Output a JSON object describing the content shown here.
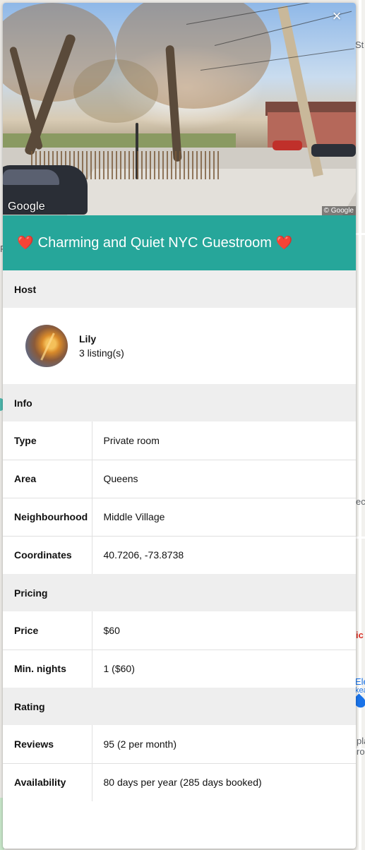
{
  "map": {
    "labels": [
      "St",
      "F",
      "ect",
      "ic",
      "Ele",
      "kea",
      "pla",
      "ron"
    ]
  },
  "photo": {
    "watermark": "Google",
    "copyright": "© Google",
    "close_icon": "×"
  },
  "listing": {
    "title": "Charming and Quiet NYC Guestroom",
    "title_icons": [
      "heart-emoji",
      "heart-emoji"
    ],
    "heart_glyph": "❤️"
  },
  "host_section": {
    "header": "Host",
    "name": "Lily",
    "listings": "3 listing(s)"
  },
  "info_section": {
    "header": "Info",
    "rows": [
      {
        "label": "Type",
        "value": "Private room"
      },
      {
        "label": "Area",
        "value": "Queens"
      },
      {
        "label": "Neighbourhood",
        "value": "Middle Village"
      },
      {
        "label": "Coordinates",
        "value": "40.7206, -73.8738"
      }
    ]
  },
  "pricing_section": {
    "header": "Pricing",
    "rows": [
      {
        "label": "Price",
        "value": "$60"
      },
      {
        "label": "Min. nights",
        "value": "1 ($60)"
      }
    ]
  },
  "rating_section": {
    "header": "Rating",
    "rows": [
      {
        "label": "Reviews",
        "value": "95 (2 per month)"
      },
      {
        "label": "Availability",
        "value": "80 days per year (285 days booked)"
      }
    ]
  },
  "colors": {
    "title_bar": "#26a69a",
    "section_header": "#eeeeee"
  }
}
